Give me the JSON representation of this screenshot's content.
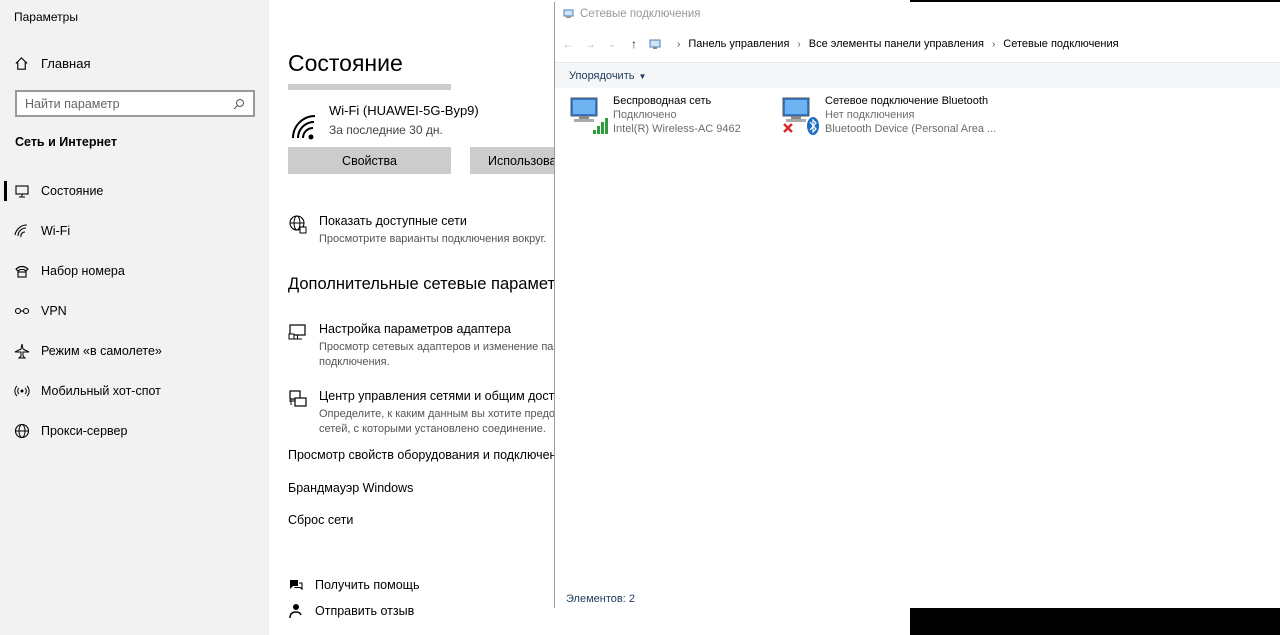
{
  "settings": {
    "app_title": "Параметры",
    "home_label": "Главная",
    "search_placeholder": "Найти параметр",
    "section_title": "Сеть и Интернет",
    "nav": [
      {
        "label": "Состояние",
        "icon": "status-icon",
        "active": true
      },
      {
        "label": "Wi-Fi",
        "icon": "wifi-icon"
      },
      {
        "label": "Набор номера",
        "icon": "dialup-icon"
      },
      {
        "label": "VPN",
        "icon": "vpn-icon"
      },
      {
        "label": "Режим «в самолете»",
        "icon": "airplane-icon"
      },
      {
        "label": "Мобильный хот-спот",
        "icon": "hotspot-icon"
      },
      {
        "label": "Прокси-сервер",
        "icon": "globe-icon"
      }
    ],
    "page_title": "Состояние",
    "wifi": {
      "name": "Wi-Fi (HUAWEI-5G-Byp9)",
      "subtitle": "За последние 30 дн."
    },
    "buttons": {
      "properties": "Свойства",
      "usage": "Использова"
    },
    "show_networks": {
      "title": "Показать доступные сети",
      "desc": "Просмотрите варианты подключения вокруг."
    },
    "advanced_heading": "Дополнительные сетевые парамет",
    "adapter": {
      "title": "Настройка параметров адаптера",
      "desc1": "Просмотр сетевых адаптеров и изменение пар",
      "desc2": "подключения."
    },
    "sharing": {
      "title": "Центр управления сетями и общим доступ",
      "desc1": "Определите, к каким данным вы хотите предос",
      "desc2": "сетей, с которыми установлено соединение."
    },
    "links": [
      "Просмотр свойств оборудования и подключения",
      "Брандмауэр Windows",
      "Сброс сети"
    ],
    "help": {
      "get_help": "Получить помощь",
      "feedback": "Отправить отзыв"
    }
  },
  "netconn": {
    "title": "Сетевые подключения",
    "breadcrumbs": [
      "Панель управления",
      "Все элементы панели управления",
      "Сетевые подключения"
    ],
    "organize": "Упорядочить",
    "connections": [
      {
        "name": "Беспроводная сеть",
        "status": "Подключено",
        "device": "Intel(R) Wireless-AC 9462"
      },
      {
        "name": "Сетевое подключение Bluetooth",
        "status": "Нет подключения",
        "device": "Bluetooth Device (Personal Area ..."
      }
    ],
    "status_bar": "Элементов: 2"
  },
  "colors": {
    "sidebar_bg": "#f2f2f2",
    "button_bg": "#cccccc",
    "explorer_text": "#1e395b",
    "error_red": "#d92b2b",
    "bluetooth_blue": "#1b6ec2"
  }
}
